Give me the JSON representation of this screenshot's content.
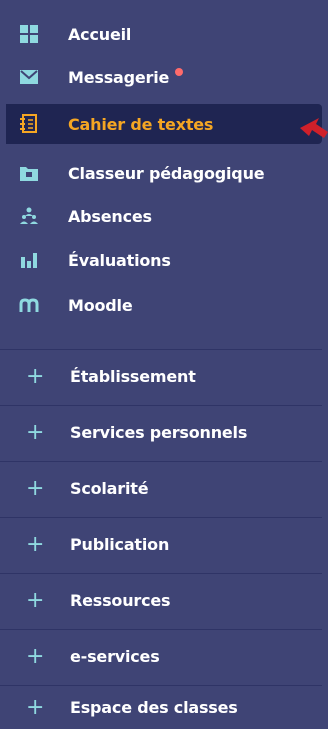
{
  "menu": {
    "items": [
      {
        "label": "Accueil",
        "icon": "grid-icon"
      },
      {
        "label": "Messagerie",
        "icon": "envelope-icon",
        "badge_color": "#ff6b6b"
      },
      {
        "label": "Cahier de textes",
        "icon": "notebook-icon",
        "active": true
      },
      {
        "label": "Classeur pédagogique",
        "icon": "folder-icon"
      },
      {
        "label": "Absences",
        "icon": "people-icon"
      },
      {
        "label": "Évaluations",
        "icon": "bar-chart-icon"
      },
      {
        "label": "Moodle",
        "icon": "moodle-icon"
      }
    ]
  },
  "sections": [
    {
      "label": "Établissement"
    },
    {
      "label": "Services personnels"
    },
    {
      "label": "Scolarité"
    },
    {
      "label": "Publication"
    },
    {
      "label": "Ressources"
    },
    {
      "label": "e-services"
    },
    {
      "label": "Espace des classes"
    }
  ],
  "colors": {
    "panel_bg": "#3f4475",
    "active_bg": "#1f2552",
    "active_text": "#f5a623",
    "icon_blue": "#8fd9e0",
    "annotation_arrow": "#d0202a"
  }
}
